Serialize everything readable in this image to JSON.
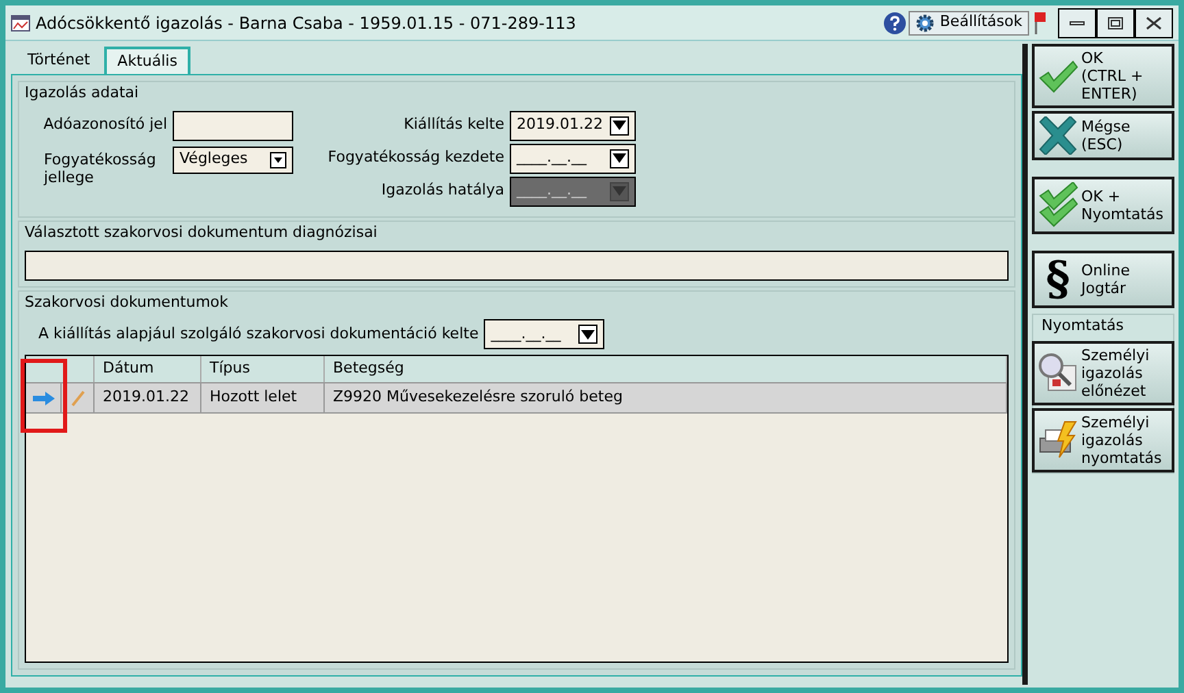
{
  "window": {
    "title": "Adócsökkentő igazolás - Barna Csaba - 1959.01.15 - 071-289-113",
    "settings_button": "Beállítások"
  },
  "tabs": [
    {
      "label": "Történet",
      "selected": false
    },
    {
      "label": "Aktuális",
      "selected": true
    }
  ],
  "certificate": {
    "title": "Igazolás adatai",
    "tax_id": {
      "label": "Adóazonosító jel"
    },
    "disability_type": {
      "label": "Fogyatékosság jellege",
      "value": "Végleges"
    },
    "dates": [
      {
        "label": "Kiállítás kelte",
        "value": "2019.01.22",
        "disabled": false
      },
      {
        "label": "Fogyatékosság kezdete",
        "placeholder": "____.__.__",
        "disabled": false
      },
      {
        "label": "Igazolás hatálya",
        "placeholder": "____.__.__",
        "disabled": true
      }
    ]
  },
  "diagnoses": {
    "title": "Választott szakorvosi dokumentum diagnózisai"
  },
  "documents": {
    "title": "Szakorvosi dokumentumok",
    "date": {
      "label": "A kiállítás alapjául szolgáló szakorvosi dokumentáció kelte",
      "placeholder": "____.__.__"
    },
    "columns": [
      "Dátum",
      "Típus",
      "Betegség"
    ],
    "rows": [
      {
        "selected": true,
        "cells": [
          "2019.01.22",
          "Hozott lelet",
          "Z9920 Művesekezelésre szoruló beteg"
        ]
      }
    ]
  },
  "actions": [
    {
      "kind": "ok",
      "label": "OK\n(CTRL +\nENTER)"
    },
    {
      "kind": "cancel",
      "label": "Mégse\n(ESC)"
    },
    {
      "kind": "ok-print",
      "label": "OK +\nNyomtatás"
    },
    {
      "kind": "law",
      "glyph": "§",
      "label": "Online\nJogtár"
    }
  ],
  "print_group": {
    "title": "Nyomtatás",
    "buttons": [
      {
        "kind": "preview",
        "label": "Személyi\nigazolás\nelőnézet"
      },
      {
        "kind": "print",
        "label": "Személyi\nigazolás\nnyomtatás"
      }
    ]
  }
}
